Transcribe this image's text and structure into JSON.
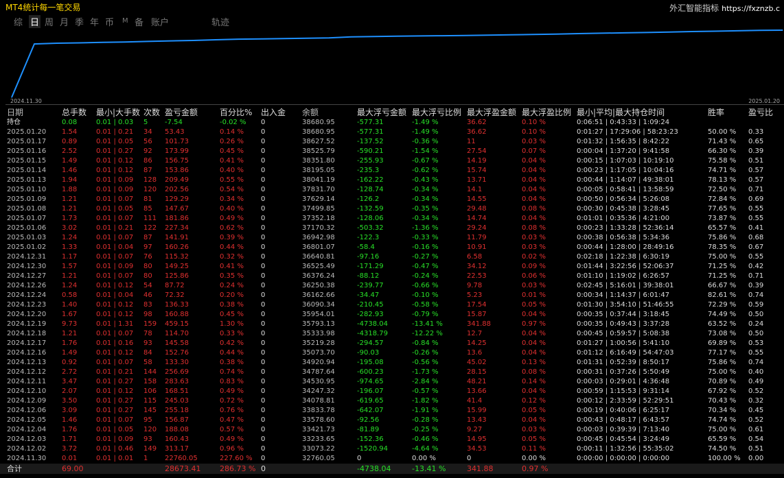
{
  "app_title": "MT4统计每一笔交易",
  "brand": {
    "name": "外汇智能指标",
    "site": "https://fxznzb.c"
  },
  "tabs": [
    {
      "label": "综",
      "active": false
    },
    {
      "label": "日",
      "active": true
    },
    {
      "label": "周",
      "active": false
    },
    {
      "label": "月",
      "active": false
    },
    {
      "label": "季",
      "active": false
    },
    {
      "label": "年",
      "active": false
    },
    {
      "label": "币",
      "active": false
    },
    {
      "label": "M",
      "active": false
    },
    {
      "label": "备",
      "active": false
    },
    {
      "label": "账户",
      "active": false
    },
    {
      "label": "轨迹",
      "active": false
    }
  ],
  "chart_data": {
    "type": "line",
    "x": [
      "2024.11.30",
      "2024.12.02",
      "2024.12.03",
      "2024.12.04",
      "2024.12.05",
      "2024.12.06",
      "2024.12.09",
      "2024.12.10",
      "2024.12.11",
      "2024.12.12",
      "2024.12.13",
      "2024.12.16",
      "2024.12.17",
      "2024.12.18",
      "2024.12.19",
      "2024.12.20",
      "2024.12.23",
      "2024.12.24",
      "2024.12.26",
      "2024.12.27",
      "2024.12.30",
      "2024.12.31",
      "2025.01.02",
      "2025.01.03",
      "2025.01.06",
      "2025.01.07",
      "2025.01.08",
      "2025.01.09",
      "2025.01.10",
      "2025.01.13",
      "2025.01.14",
      "2025.01.15",
      "2025.01.16",
      "2025.01.17",
      "2025.01.20"
    ],
    "values": [
      10000,
      32760.05,
      33073.22,
      33233.65,
      33421.73,
      33578.6,
      33833.78,
      34078.81,
      34247.32,
      34530.95,
      34787.64,
      34920.94,
      35073.7,
      35219.28,
      35333.98,
      35793.13,
      35954.01,
      36090.34,
      36162.66,
      36250.38,
      36376.24,
      36525.49,
      36640.81,
      36801.07,
      36942.98,
      37170.32,
      37352.18,
      37499.85,
      37629.14,
      37831.7,
      38041.19,
      38195.05,
      38351.8,
      38525.79,
      38627.52
    ],
    "x_start_label": "2024.11.30",
    "x_end_label": "2025.01.20",
    "line_color": "#1e90ff",
    "grid": false
  },
  "table": {
    "headers": [
      "日期",
      "总手数",
      "最小|大手数",
      "次数",
      "盈亏金额",
      "百分比%",
      "出入金",
      "余额",
      "最大浮亏金额",
      "最大浮亏比例",
      "最大浮盈金额",
      "最大浮盈比例",
      "最小|平均|最大持仓时间",
      "胜率",
      "盈亏比"
    ],
    "holding": {
      "cells": [
        "持仓",
        "0.08",
        "0.01 | 0.03",
        "5",
        "-7.54",
        "-0.02 %",
        "0",
        "38680.95",
        "-577.31",
        "-1.49 %",
        "36.62",
        "0.10 %",
        "0:06:51 | 0:43:33 | 1:09:24",
        "",
        ""
      ],
      "colors": [
        "white",
        "green",
        "green",
        "green",
        "green",
        "green",
        "white",
        "grey",
        "green",
        "green",
        "red",
        "red",
        "white",
        "white",
        "white"
      ]
    },
    "rows": [
      [
        "2025.01.20",
        "1.54",
        "0.01 | 0.21",
        "34",
        "53.43",
        "0.14 %",
        "0",
        "38680.95",
        "-577.31",
        "-1.49 %",
        "36.62",
        "0.10 %",
        "0:01:27 | 17:29:06 | 58:23:23",
        "50.00 %",
        "0.33"
      ],
      [
        "2025.01.17",
        "0.89",
        "0.01 | 0.05",
        "56",
        "101.73",
        "0.26 %",
        "0",
        "38627.52",
        "-137.52",
        "-0.36 %",
        "11",
        "0.03 %",
        "0:01:32 | 1:56:35 | 8:42:22",
        "71.43 %",
        "0.65"
      ],
      [
        "2025.01.16",
        "2.52",
        "0.01 | 0.27",
        "92",
        "173.99",
        "0.45 %",
        "0",
        "38525.79",
        "-590.21",
        "-1.54 %",
        "27.54",
        "0.07 %",
        "0:00:04 | 1:37:20 | 9:41:58",
        "66.30 %",
        "0.39"
      ],
      [
        "2025.01.15",
        "1.49",
        "0.01 | 0.12",
        "86",
        "156.75",
        "0.41 %",
        "0",
        "38351.80",
        "-255.93",
        "-0.67 %",
        "14.19",
        "0.04 %",
        "0:00:15 | 1:07:03 | 10:19:10",
        "75.58 %",
        "0.51"
      ],
      [
        "2025.01.14",
        "1.46",
        "0.01 | 0.12",
        "87",
        "153.86",
        "0.40 %",
        "0",
        "38195.05",
        "-235.3",
        "-0.62 %",
        "15.74",
        "0.04 %",
        "0:00:23 | 1:17:05 | 10:04:16",
        "74.71 %",
        "0.57"
      ],
      [
        "2025.01.13",
        "1.94",
        "0.01 | 0.09",
        "128",
        "209.49",
        "0.55 %",
        "0",
        "38041.19",
        "-162.22",
        "-0.43 %",
        "13.71",
        "0.04 %",
        "0:00:44 | 1:14:07 | 49:38:01",
        "78.13 %",
        "0.57"
      ],
      [
        "2025.01.10",
        "1.88",
        "0.01 | 0.09",
        "120",
        "202.56",
        "0.54 %",
        "0",
        "37831.70",
        "-128.74",
        "-0.34 %",
        "14.1",
        "0.04 %",
        "0:00:05 | 0:58:41 | 13:58:59",
        "72.50 %",
        "0.71"
      ],
      [
        "2025.01.09",
        "1.21",
        "0.01 | 0.07",
        "81",
        "129.29",
        "0.34 %",
        "0",
        "37629.14",
        "-126.2",
        "-0.34 %",
        "14.55",
        "0.04 %",
        "0:00:50 | 0:56:34 | 5:26:08",
        "72.84 %",
        "0.69"
      ],
      [
        "2025.01.08",
        "1.21",
        "0.01 | 0.05",
        "85",
        "147.67",
        "0.40 %",
        "0",
        "37499.85",
        "-132.59",
        "-0.35 %",
        "29.48",
        "0.08 %",
        "0:00:30 | 0:45:38 | 3:28:45",
        "77.65 %",
        "0.55"
      ],
      [
        "2025.01.07",
        "1.73",
        "0.01 | 0.07",
        "111",
        "181.86",
        "0.49 %",
        "0",
        "37352.18",
        "-128.06",
        "-0.34 %",
        "14.74",
        "0.04 %",
        "0:01:01 | 0:35:36 | 4:21:00",
        "73.87 %",
        "0.55"
      ],
      [
        "2025.01.06",
        "3.02",
        "0.01 | 0.21",
        "122",
        "227.34",
        "0.62 %",
        "0",
        "37170.32",
        "-503.32",
        "-1.36 %",
        "29.24",
        "0.08 %",
        "0:00:23 | 1:33:28 | 52:36:14",
        "65.57 %",
        "0.41"
      ],
      [
        "2025.01.03",
        "1.24",
        "0.01 | 0.07",
        "87",
        "141.91",
        "0.39 %",
        "0",
        "36942.98",
        "-122.3",
        "-0.33 %",
        "11.79",
        "0.03 %",
        "0:00:38 | 0:56:38 | 5:34:36",
        "75.86 %",
        "0.68"
      ],
      [
        "2025.01.02",
        "1.33",
        "0.01 | 0.04",
        "97",
        "160.26",
        "0.44 %",
        "0",
        "36801.07",
        "-58.4",
        "-0.16 %",
        "10.91",
        "0.03 %",
        "0:00:44 | 1:28:00 | 28:49:16",
        "78.35 %",
        "0.67"
      ],
      [
        "2024.12.31",
        "1.17",
        "0.01 | 0.07",
        "76",
        "115.32",
        "0.32 %",
        "0",
        "36640.81",
        "-97.16",
        "-0.27 %",
        "6.58",
        "0.02 %",
        "0:02:18 | 1:22:38 | 6:30:19",
        "75.00 %",
        "0.55"
      ],
      [
        "2024.12.30",
        "1.57",
        "0.01 | 0.09",
        "80",
        "149.25",
        "0.41 %",
        "0",
        "36525.49",
        "-171.29",
        "-0.47 %",
        "34.12",
        "0.09 %",
        "0:01:44 | 3:22:56 | 52:06:37",
        "71.25 %",
        "0.42"
      ],
      [
        "2024.12.27",
        "1.21",
        "0.01 | 0.07",
        "80",
        "125.86",
        "0.35 %",
        "0",
        "36376.24",
        "-88.12",
        "-0.24 %",
        "22.53",
        "0.06 %",
        "0:01:10 | 1:19:02 | 6:26:57",
        "71.25 %",
        "0.71"
      ],
      [
        "2024.12.26",
        "1.24",
        "0.01 | 0.12",
        "54",
        "87.72",
        "0.24 %",
        "0",
        "36250.38",
        "-239.77",
        "-0.66 %",
        "9.78",
        "0.03 %",
        "0:02:45 | 5:16:01 | 39:38:01",
        "66.67 %",
        "0.39"
      ],
      [
        "2024.12.24",
        "0.58",
        "0.01 | 0.04",
        "46",
        "72.32",
        "0.20 %",
        "0",
        "36162.66",
        "-34.47",
        "-0.10 %",
        "5.23",
        "0.01 %",
        "0:00:34 | 1:14:37 | 6:01:47",
        "82.61 %",
        "0.74"
      ],
      [
        "2024.12.23",
        "1.40",
        "0.01 | 0.12",
        "83",
        "136.33",
        "0.38 %",
        "0",
        "36090.34",
        "-210.45",
        "-0.58 %",
        "17.54",
        "0.05 %",
        "0:01:30 | 3:54:10 | 51:46:55",
        "72.29 %",
        "0.59"
      ],
      [
        "2024.12.20",
        "1.67",
        "0.01 | 0.12",
        "98",
        "160.88",
        "0.45 %",
        "0",
        "35954.01",
        "-282.93",
        "-0.79 %",
        "15.87",
        "0.04 %",
        "0:00:35 | 0:37:44 | 3:18:45",
        "74.49 %",
        "0.50"
      ],
      [
        "2024.12.19",
        "9.73",
        "0.01 | 1.31",
        "159",
        "459.15",
        "1.30 %",
        "0",
        "35793.13",
        "-4738.04",
        "-13.41 %",
        "341.88",
        "0.97 %",
        "0:00:35 | 0:49:43 | 3:37:28",
        "63.52 %",
        "0.24"
      ],
      [
        "2024.12.18",
        "1.21",
        "0.01 | 0.07",
        "78",
        "114.70",
        "0.33 %",
        "0",
        "35333.98",
        "-4318.79",
        "-12.22 %",
        "12.7",
        "0.04 %",
        "0:00:45 | 0:59:57 | 5:08:38",
        "73.08 %",
        "0.50"
      ],
      [
        "2024.12.17",
        "1.76",
        "0.01 | 0.16",
        "93",
        "145.58",
        "0.42 %",
        "0",
        "35219.28",
        "-294.57",
        "-0.84 %",
        "14.25",
        "0.04 %",
        "0:01:27 | 1:00:56 | 5:41:10",
        "69.89 %",
        "0.53"
      ],
      [
        "2024.12.16",
        "1.49",
        "0.01 | 0.12",
        "84",
        "152.76",
        "0.44 %",
        "0",
        "35073.70",
        "-90.03",
        "-0.26 %",
        "13.6",
        "0.04 %",
        "0:01:12 | 6:16:49 | 54:47:03",
        "77.17 %",
        "0.55"
      ],
      [
        "2024.12.13",
        "0.92",
        "0.01 | 0.07",
        "58",
        "133.30",
        "0.38 %",
        "0",
        "34920.94",
        "-195.08",
        "-0.56 %",
        "45.02",
        "0.13 %",
        "0:01:31 | 0:52:39 | 8:50:17",
        "75.86 %",
        "0.74"
      ],
      [
        "2024.12.12",
        "2.72",
        "0.01 | 0.21",
        "144",
        "256.69",
        "0.74 %",
        "0",
        "34787.64",
        "-600.23",
        "-1.73 %",
        "28.15",
        "0.08 %",
        "0:00:31 | 0:37:26 | 5:50:49",
        "75.00 %",
        "0.40"
      ],
      [
        "2024.12.11",
        "3.47",
        "0.01 | 0.27",
        "158",
        "283.63",
        "0.83 %",
        "0",
        "34530.95",
        "-974.65",
        "-2.84 %",
        "48.21",
        "0.14 %",
        "0:00:03 | 0:29:01 | 4:36:48",
        "70.89 %",
        "0.49"
      ],
      [
        "2024.12.10",
        "2.07",
        "0.01 | 0.12",
        "106",
        "168.51",
        "0.49 %",
        "0",
        "34247.32",
        "-196.07",
        "-0.57 %",
        "13.66",
        "0.04 %",
        "0:00:59 | 1:15:53 | 9:31:14",
        "67.92 %",
        "0.52"
      ],
      [
        "2024.12.09",
        "3.50",
        "0.01 | 0.27",
        "115",
        "245.03",
        "0.72 %",
        "0",
        "34078.81",
        "-619.65",
        "-1.82 %",
        "41.4",
        "0.12 %",
        "0:00:12 | 2:33:59 | 52:29:51",
        "70.43 %",
        "0.32"
      ],
      [
        "2024.12.06",
        "3.09",
        "0.01 | 0.27",
        "145",
        "255.18",
        "0.76 %",
        "0",
        "33833.78",
        "-642.07",
        "-1.91 %",
        "15.99",
        "0.05 %",
        "0:00:19 | 0:40:06 | 6:25:17",
        "70.34 %",
        "0.45"
      ],
      [
        "2024.12.05",
        "1.46",
        "0.01 | 0.07",
        "95",
        "156.87",
        "0.47 %",
        "0",
        "33578.60",
        "-92.56",
        "-0.28 %",
        "13.43",
        "0.04 %",
        "0:00:43 | 0:48:17 | 6:43:57",
        "74.74 %",
        "0.52"
      ],
      [
        "2024.12.04",
        "1.76",
        "0.01 | 0.05",
        "120",
        "188.08",
        "0.57 %",
        "0",
        "33421.73",
        "-81.89",
        "-0.25 %",
        "9.27",
        "0.03 %",
        "0:00:03 | 0:39:39 | 7:13:40",
        "75.00 %",
        "0.61"
      ],
      [
        "2024.12.03",
        "1.71",
        "0.01 | 0.09",
        "93",
        "160.43",
        "0.49 %",
        "0",
        "33233.65",
        "-152.36",
        "-0.46 %",
        "14.95",
        "0.05 %",
        "0:00:45 | 0:45:54 | 3:24:49",
        "65.59 %",
        "0.54"
      ],
      [
        "2024.12.02",
        "3.72",
        "0.01 | 0.46",
        "149",
        "313.17",
        "0.96 %",
        "0",
        "33073.22",
        "-1520.94",
        "-4.64 %",
        "34.53",
        "0.11 %",
        "0:00:11 | 1:32:56 | 55:35:02",
        "74.50 %",
        "0.51"
      ],
      [
        "2024.11.30",
        "0.01",
        "0.01 | 0.01",
        "1",
        "22760.05",
        "227.60 %",
        "0",
        "32760.05",
        "0",
        "0.00 %",
        "0",
        "0.00 %",
        "0:00:00 | 0:00:00 | 0:00:00",
        "100.00 %",
        "0.00"
      ]
    ],
    "row_colors": [
      "grey",
      "red",
      "red",
      "red",
      "red",
      "red",
      "white",
      "grey",
      "green",
      "green",
      "red",
      "red",
      "white",
      "white",
      "white"
    ],
    "last_row_colors": [
      "grey",
      "red",
      "red",
      "red",
      "red",
      "red",
      "white",
      "grey",
      "white",
      "white",
      "white",
      "white",
      "white",
      "white",
      "white"
    ],
    "total": {
      "cells": [
        "合计",
        "69.00",
        "",
        "",
        "28673.41",
        "286.73 %",
        "0",
        "",
        "-4738.04",
        "-13.41 %",
        "341.88",
        "0.97 %",
        "",
        "",
        ""
      ],
      "colors": [
        "white",
        "red",
        "red",
        "red",
        "red",
        "red",
        "white",
        "grey",
        "green",
        "green",
        "red",
        "red",
        "white",
        "white",
        "white"
      ]
    }
  }
}
